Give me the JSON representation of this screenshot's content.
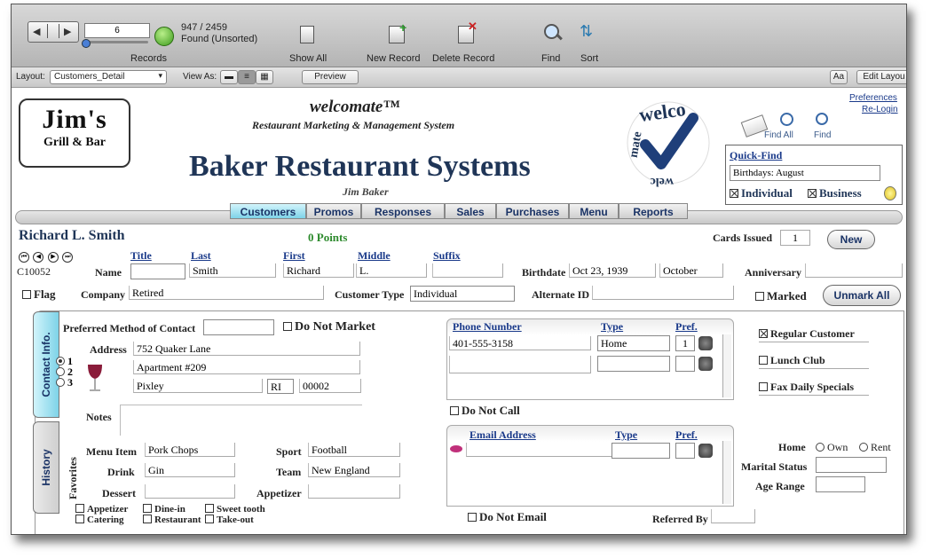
{
  "toolbar": {
    "record_number": "6",
    "total_records": "947 / 2459",
    "found_status": "Found (Unsorted)",
    "records_label": "Records",
    "show_all": "Show All",
    "new_record": "New Record",
    "delete_record": "Delete Record",
    "find": "Find",
    "sort": "Sort"
  },
  "layoutbar": {
    "layout_label": "Layout:",
    "layout_value": "Customers_Detail",
    "view_as_label": "View As:",
    "preview": "Preview",
    "aa": "Aa",
    "edit_layout": "Edit Layou"
  },
  "header": {
    "logo_line1": "Jim's",
    "logo_line2": "Grill & Bar",
    "brand": "welcomate™",
    "tagline": "Restaurant Marketing & Management System",
    "company": "Baker Restaurant Systems",
    "owner": "Jim Baker",
    "seal_text": "welcomate",
    "preferences": "Preferences",
    "relogin": "Re-Login",
    "find_all": "Find All",
    "find": "Find",
    "quick_find_label": "Quick-Find",
    "quick_find_value": "Birthdays:  August",
    "individual": "Individual",
    "business": "Business"
  },
  "tabs": [
    "Customers",
    "Promos",
    "Responses",
    "Sales",
    "Purchases",
    "Menu",
    "Reports"
  ],
  "customer": {
    "full_name": "Richard L. Smith",
    "points": "0 Points",
    "cards_issued_label": "Cards Issued",
    "cards_issued": "1",
    "new_button": "New",
    "id": "C10052",
    "name_label": "Name",
    "title_header": "Title",
    "last_header": "Last",
    "first_header": "First",
    "middle_header": "Middle",
    "suffix_header": "Suffix",
    "title": "",
    "last": "Smith",
    "first": "Richard",
    "middle": "L.",
    "suffix": "",
    "birthdate_label": "Birthdate",
    "birthdate": "Oct 23, 1939",
    "birth_month": "October",
    "anniversary_label": "Anniversary",
    "anniversary": "",
    "flag_label": "Flag",
    "company_label": "Company",
    "company": "Retired",
    "customer_type_label": "Customer Type",
    "customer_type": "Individual",
    "alternate_id_label": "Alternate ID",
    "alternate_id": "",
    "marked_label": "Marked",
    "unmark_all": "Unmark All"
  },
  "side_tabs": {
    "contact": "Contact Info.",
    "history": "History"
  },
  "contact": {
    "preferred_label": "Preferred Method of Contact",
    "preferred": "",
    "do_not_market": "Do Not Market",
    "address_label": "Address",
    "address1": "752 Quaker Lane",
    "address2": "Apartment #209",
    "city": "Pixley",
    "state": "RI",
    "zip": "00002",
    "radio_labels": [
      "1",
      "2",
      "3"
    ],
    "notes_label": "Notes",
    "notes": ""
  },
  "phone": {
    "header_number": "Phone Number",
    "header_type": "Type",
    "header_pref": "Pref.",
    "rows": [
      {
        "number": "401-555-3158",
        "type": "Home",
        "pref": "1"
      },
      {
        "number": "",
        "type": "",
        "pref": ""
      }
    ],
    "do_not_call": "Do Not Call"
  },
  "email": {
    "header_address": "Email Address",
    "header_type": "Type",
    "header_pref": "Pref.",
    "do_not_email": "Do Not Email",
    "referred_by_label": "Referred By",
    "referred_by": ""
  },
  "options": {
    "regular_customer": "Regular Customer",
    "lunch_club": "Lunch Club",
    "fax_daily": "Fax Daily Specials",
    "home_label": "Home",
    "own": "Own",
    "rent": "Rent",
    "marital_label": "Marital Status",
    "marital": "",
    "age_label": "Age Range",
    "age": ""
  },
  "favorites": {
    "section_label": "Favorites",
    "menu_item_label": "Menu Item",
    "menu_item": "Pork Chops",
    "drink_label": "Drink",
    "drink": "Gin",
    "dessert_label": "Dessert",
    "dessert": "",
    "sport_label": "Sport",
    "sport": "Football",
    "team_label": "Team",
    "team": "New England",
    "appetizer_label": "Appetizer",
    "appetizer": "",
    "checks": [
      "Appetizer",
      "Dine-in",
      "Sweet tooth",
      "Catering",
      "Restaurant",
      "Take-out"
    ]
  }
}
